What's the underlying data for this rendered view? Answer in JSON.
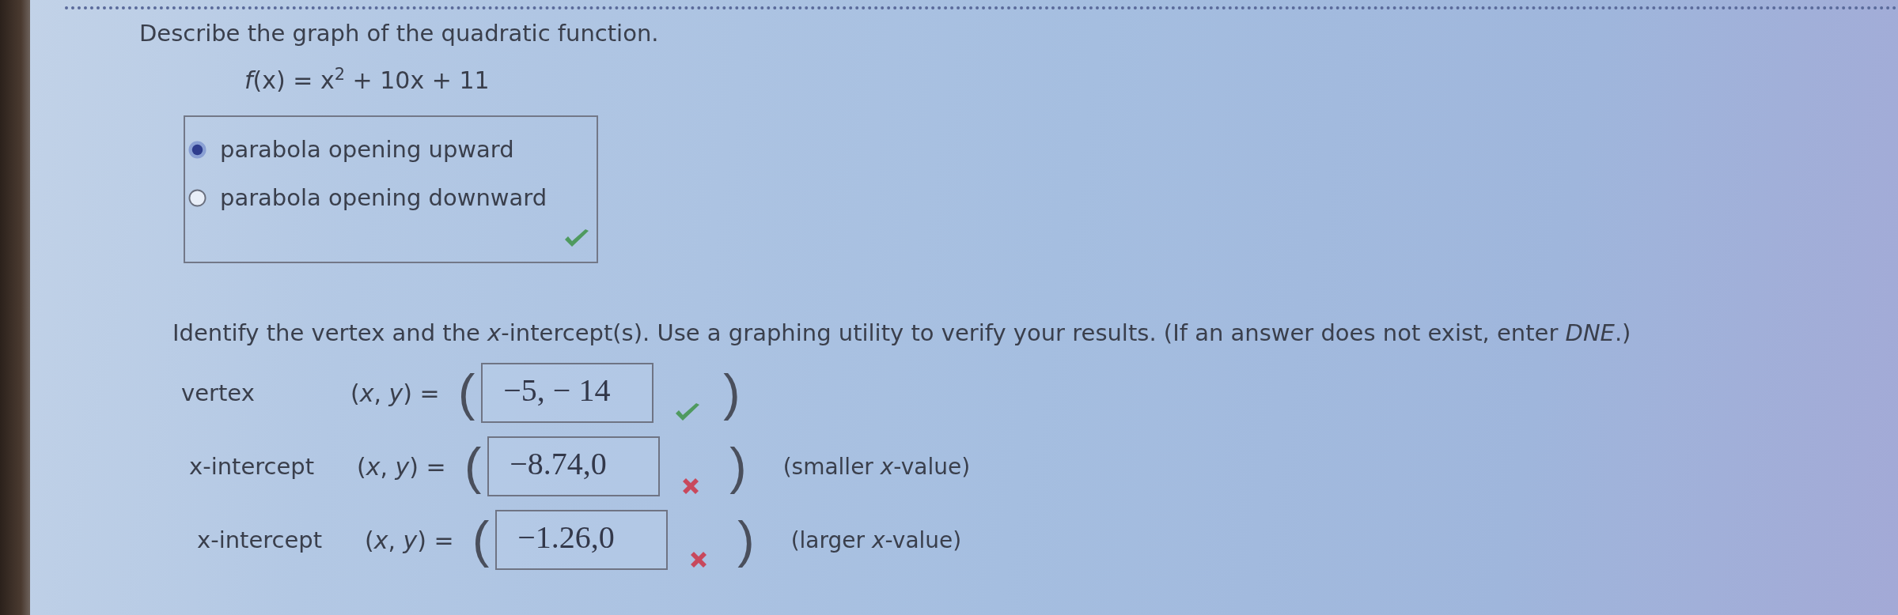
{
  "question": {
    "prompt": "Describe the graph of the quadratic function.",
    "function": "*f*(x) = x$^{2}$ + 10x + 11"
  },
  "choices": {
    "options": [
      {
        "label": "parabola opening upward",
        "selected": true
      },
      {
        "label": "parabola opening downward",
        "selected": false
      }
    ],
    "correct": true
  },
  "part_2": {
    "instructions": "Identify the vertex and the *x*-intercept(s). Use a graphing utility to verify your results. (If an answer does not exist, enter *DNE*.)",
    "rows": [
      {
        "label": "vertex",
        "coordinate_label": "(*x*, *y*) =",
        "open_paren": "(",
        "value": "−5, − 14",
        "close_paren": ")",
        "correct": true
      },
      {
        "label": "x-intercept",
        "coordinate_label": "(*x*, *y*) =",
        "open_paren": "(",
        "value": "−8.74,0",
        "close_paren": ")",
        "correct": false,
        "hint": "(smaller *x*-value)"
      },
      {
        "label": "x-intercept",
        "coordinate_label": "(*x*, *y*) =",
        "open_paren": "(",
        "value": "−1.26,0",
        "close_paren": ")",
        "correct": false,
        "hint": "(larger *x*-value)"
      }
    ]
  }
}
